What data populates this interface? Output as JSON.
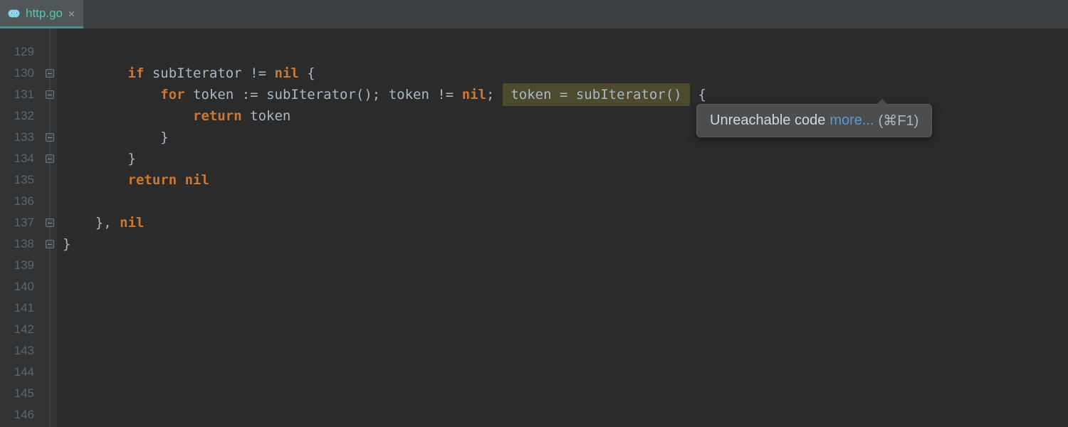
{
  "tab": {
    "filename": "http.go"
  },
  "gutter": {
    "start": 129,
    "end": 146
  },
  "code": {
    "l129": {
      "indent": "        "
    },
    "l130": {
      "indent": "        ",
      "if": "if",
      "cond_a": "subIterator",
      "op1": "!=",
      "cond_b": "nil",
      "brace": "{"
    },
    "l131": {
      "indent": "            ",
      "for": "for",
      "a": "token",
      "op_assign": ":=",
      "call1": "subIterator()",
      "sep1": ";",
      "b": "token",
      "op_ne": "!=",
      "nil": "nil",
      "sep2": ";",
      "hl": " token = subIterator() ",
      "brace": "{"
    },
    "l132": {
      "indent": "                ",
      "return": "return",
      "val": "token"
    },
    "l133": {
      "indent": "            ",
      "brace": "}"
    },
    "l134": {
      "indent": "        ",
      "brace": "}"
    },
    "l135": {
      "indent": "        ",
      "return": "return",
      "val": "nil"
    },
    "l136": {
      "indent": ""
    },
    "l137": {
      "indent": "    ",
      "brace": "}",
      "comma": ",",
      "val": "nil"
    },
    "l138": {
      "indent": "",
      "brace": "}"
    }
  },
  "tooltip": {
    "message": "Unreachable code",
    "link": "more...",
    "shortcut": "(⌘F1)"
  }
}
